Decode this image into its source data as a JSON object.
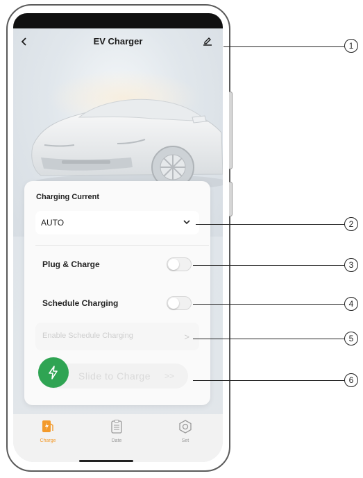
{
  "header": {
    "title": "EV Charger",
    "back_icon": "chevron-left-icon",
    "edit_icon": "pencil-icon"
  },
  "card": {
    "section_label": "Charging Current",
    "current_value": "AUTO",
    "plug_charge_label": "Plug & Charge",
    "plug_charge_on": false,
    "schedule_label": "Schedule Charging",
    "schedule_on": false,
    "enable_schedule_label": "Enable Schedule Charging",
    "slide_label": "Slide to Charge",
    "slide_arrows": ">>"
  },
  "tabs": [
    {
      "label": "Charge",
      "icon": "charge-station-icon",
      "active": true
    },
    {
      "label": "Date",
      "icon": "clipboard-icon",
      "active": false
    },
    {
      "label": "Set",
      "icon": "settings-gear-icon",
      "active": false
    }
  ],
  "colors": {
    "accent_orange": "#f39a2b",
    "slide_green": "#2fa453"
  },
  "callouts": [
    "1",
    "2",
    "3",
    "4",
    "5",
    "6"
  ]
}
